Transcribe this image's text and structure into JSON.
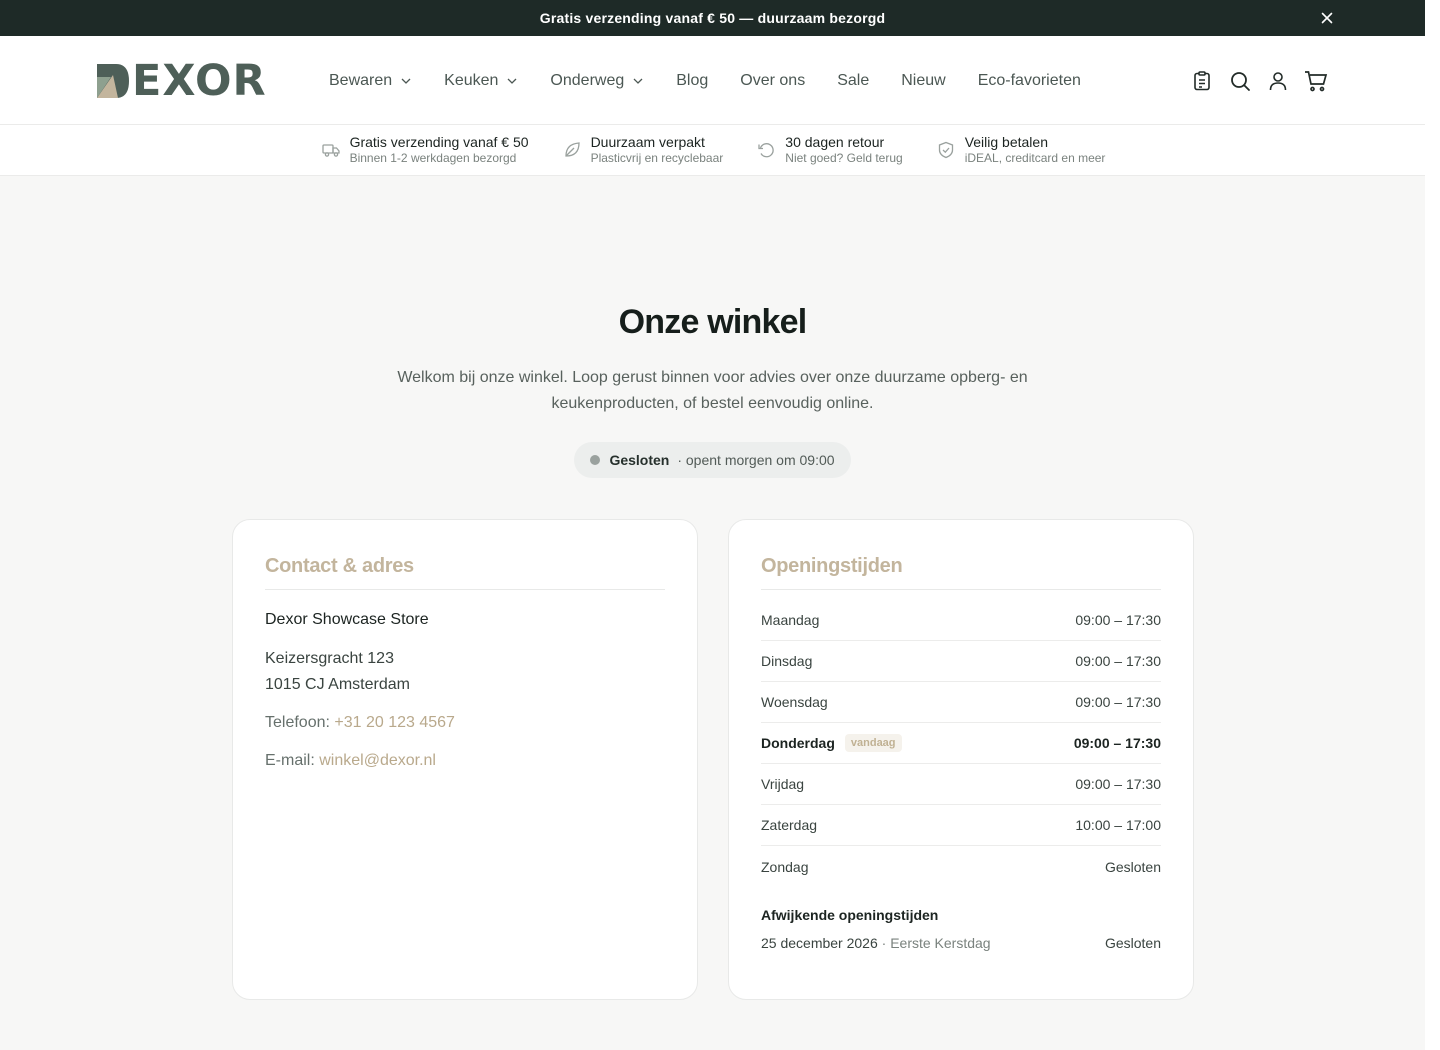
{
  "announcement": {
    "text": "Gratis verzending vanaf € 50 — duurzaam bezorgd",
    "close_icon": "close-icon"
  },
  "brand": {
    "name": "EXOR",
    "logo_color": "#4e5f58",
    "accent": "#c3b59d"
  },
  "nav": {
    "items": [
      {
        "label": "Bewaren",
        "dropdown": true
      },
      {
        "label": "Keuken",
        "dropdown": true
      },
      {
        "label": "Onderweg",
        "dropdown": true
      },
      {
        "label": "Blog",
        "dropdown": false
      },
      {
        "label": "Over ons",
        "dropdown": false
      },
      {
        "label": "Sale",
        "dropdown": false
      },
      {
        "label": "Nieuw",
        "dropdown": false
      },
      {
        "label": "Eco-favorieten",
        "dropdown": false
      }
    ],
    "icons": [
      "clipboard-icon",
      "search-icon",
      "account-icon",
      "cart-icon"
    ]
  },
  "usps": [
    {
      "icon": "truck-icon",
      "title": "Gratis verzending vanaf € 50",
      "subtitle": "Binnen 1-2 werkdagen bezorgd"
    },
    {
      "icon": "leaf-icon",
      "title": "Duurzaam verpakt",
      "subtitle": "Plasticvrij en recyclebaar"
    },
    {
      "icon": "return-icon",
      "title": "30 dagen retour",
      "subtitle": "Niet goed? Geld terug"
    },
    {
      "icon": "shield-icon",
      "title": "Veilig betalen",
      "subtitle": "iDEAL, creditcard en meer"
    }
  ],
  "hero": {
    "title": "Onze winkel",
    "intro": "Welkom bij onze winkel. Loop gerust binnen voor advies over onze duurzame opberg- en keukenproducten, of bestel eenvoudig online.",
    "status_label": "Gesloten",
    "status_detail": "· opent morgen om 09:00",
    "status_color": "#9aa19e"
  },
  "contact": {
    "title": "Contact & adres",
    "store_name": "Dexor Showcase Store",
    "street": "Keizersgracht 123",
    "city": "1015 CJ Amsterdam",
    "phone_label": "Telefoon:",
    "phone": "+31 20 123 4567",
    "email_label": "E-mail:",
    "email": "winkel@dexor.nl"
  },
  "hours": {
    "title": "Openingstijden",
    "today_badge": "vandaag",
    "rows": [
      {
        "day": "Maandag",
        "time": "09:00 – 17:30"
      },
      {
        "day": "Dinsdag",
        "time": "09:00 – 17:30"
      },
      {
        "day": "Woensdag",
        "time": "09:00 – 17:30"
      },
      {
        "day": "Donderdag",
        "time": "09:00 – 17:30"
      },
      {
        "day": "Vrijdag",
        "time": "09:00 – 17:30"
      },
      {
        "day": "Zaterdag",
        "time": "10:00 – 17:00"
      },
      {
        "day": "Zondag",
        "time": "Gesloten"
      }
    ],
    "deviating_title": "Afwijkende openingstijden",
    "deviating": {
      "date": "25 december 2026",
      "note": "· Eerste Kerstdag",
      "status": "Gesloten"
    }
  }
}
